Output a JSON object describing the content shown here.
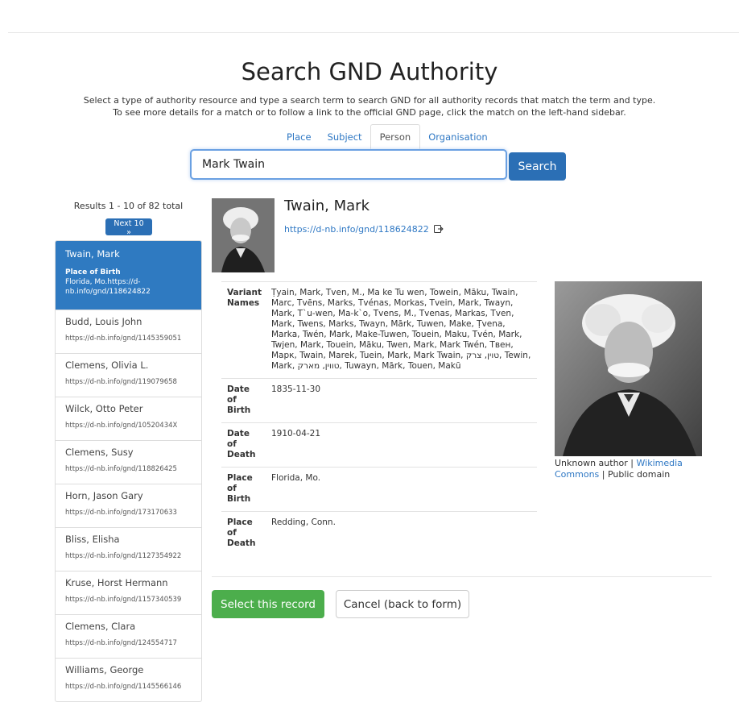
{
  "page": {
    "title": "Search GND Authority",
    "intro_line1": "Select a type of authority resource and type a search term to search GND for all authority records that match the term and type.",
    "intro_line2": "To see more details for a match or to follow a link to the official GND page, click the match on the left-hand sidebar."
  },
  "tabs": [
    {
      "label": "Place",
      "active": false
    },
    {
      "label": "Subject",
      "active": false
    },
    {
      "label": "Person",
      "active": true
    },
    {
      "label": "Organisation",
      "active": false
    }
  ],
  "search": {
    "value": "Mark Twain",
    "button_label": "Search"
  },
  "results": {
    "count_text": "Results 1 - 10 of 82 total",
    "next_label": "Next 10 »",
    "items": [
      {
        "name": "Twain, Mark",
        "sub_label": "Place of Birth",
        "sub_text": "Florida, Mo.https://d-nb.info/gnd/118624822",
        "url": "",
        "active": true
      },
      {
        "name": "Budd, Louis John",
        "url": "https://d-nb.info/gnd/1145359051"
      },
      {
        "name": "Clemens, Olivia L.",
        "url": "https://d-nb.info/gnd/119079658"
      },
      {
        "name": "Wilck, Otto Peter",
        "url": "https://d-nb.info/gnd/10520434X"
      },
      {
        "name": "Clemens, Susy",
        "url": "https://d-nb.info/gnd/118826425"
      },
      {
        "name": "Horn, Jason Gary",
        "url": "https://d-nb.info/gnd/173170633"
      },
      {
        "name": "Bliss, Elisha",
        "url": "https://d-nb.info/gnd/1127354922"
      },
      {
        "name": "Kruse, Horst Hermann",
        "url": "https://d-nb.info/gnd/1157340539"
      },
      {
        "name": "Clemens, Clara",
        "url": "https://d-nb.info/gnd/124554717"
      },
      {
        "name": "Williams, George",
        "url": "https://d-nb.info/gnd/1145566146"
      }
    ]
  },
  "detail": {
    "name": "Twain, Mark",
    "url": "https://d-nb.info/gnd/118624822",
    "fields": [
      {
        "label": "Variant Names",
        "value": "Ṭyain, Mark, Tven, M., Ma ke Tu wen, Towein, Māku, Twain, Marc, Tvēns, Marks, Tvénas, Morkas, Tvein, Mark, Twayn, Mark, T`u-wen, Ma-k`o, Tvens, M., Tvenas, Markas, Tven, Mark, Twens, Marks, Twayn, Mārk, Tuwen, Make, Ṭvena, Marka, Twén, Mark, Make-Tuwen, Touein, Maku, Tvén, Mark, Twjen, Mark, Touein, Māku, Twen, Mark, Mark Twén, Твен, Марк, Twain, Marek, Tuein, Mark, Mark Twain, טוין, צרק, Tewin, Mark, טווין, מארק, Tuwayn, Mārk, Touen, Makū"
      },
      {
        "label": "Date of Birth",
        "value": "1835-11-30"
      },
      {
        "label": "Date of Death",
        "value": "1910-04-21"
      },
      {
        "label": "Place of Birth",
        "value": "Florida, Mo."
      },
      {
        "label": "Place of Death",
        "value": "Redding, Conn."
      }
    ],
    "image_credit": {
      "author": "Unknown author",
      "sep1": " | ",
      "source": "Wikimedia Commons",
      "sep2": " | ",
      "license": "Public domain"
    }
  },
  "actions": {
    "select_label": "Select this record",
    "cancel_label": "Cancel (back to form)"
  },
  "colors": {
    "primary": "#2b6fb5",
    "active_item": "#2f7ac1",
    "success": "#4cae4c",
    "link": "#2f78c4"
  }
}
